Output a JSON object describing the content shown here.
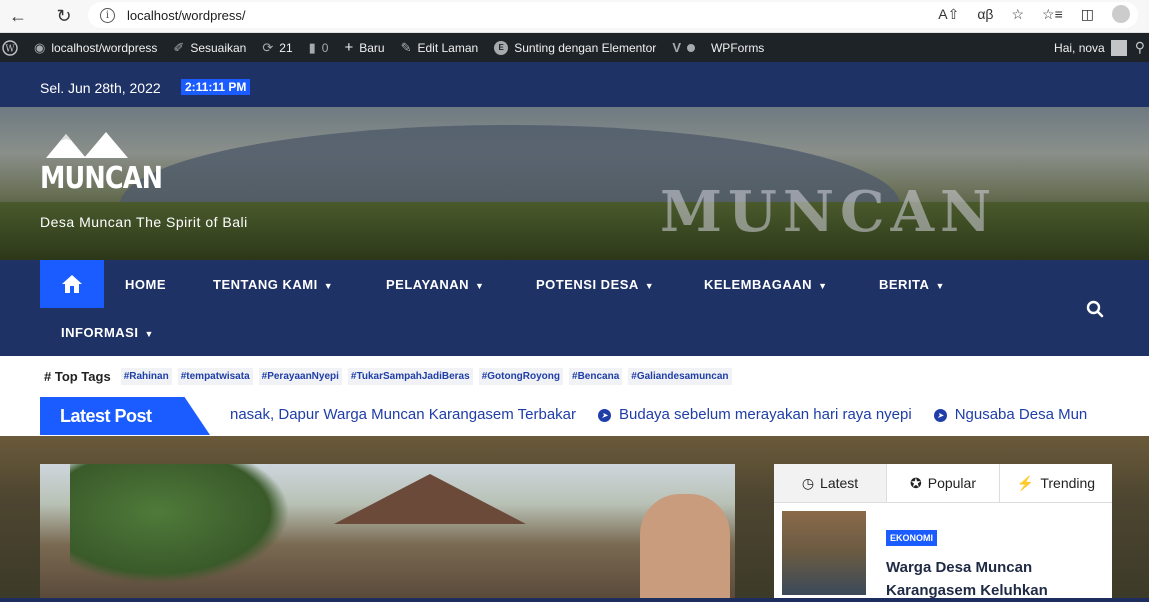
{
  "browser": {
    "url": "localhost/wordpress/"
  },
  "adminbar": {
    "site": "localhost/wordpress",
    "customize": "Sesuaikan",
    "updates": "21",
    "comments": "0",
    "new": "Baru",
    "edit": "Edit Laman",
    "elementor": "Sunting dengan Elementor",
    "wpforms": "WPForms",
    "greeting": "Hai, nova"
  },
  "header": {
    "date": "Sel. Jun 28th, 2022",
    "time": "2:11:11 PM",
    "site_title": "MUNCAN",
    "tagline": "Desa Muncan The Spirit of Bali",
    "banner_text": "MUNCAN"
  },
  "nav": {
    "items": [
      "HOME",
      "TENTANG KAMI",
      "PELAYANAN",
      "POTENSI DESA",
      "KELEMBAGAAN",
      "BERITA",
      "INFORMASI"
    ]
  },
  "tags": {
    "label": "# Top Tags",
    "items": [
      "#Rahinan",
      "#tempatwisata",
      "#PerayaanNyepi",
      "#TukarSampahJadiBeras",
      "#GotongRoyong",
      "#Bencana",
      "#Galiandesamuncan"
    ]
  },
  "ticker": {
    "label": "Latest Post",
    "items": [
      "nasak, Dapur Warga Muncan Karangasem Terbakar",
      "Budaya sebelum merayakan hari raya nyepi",
      "Ngusaba Desa Mun"
    ]
  },
  "widget": {
    "tabs": [
      "Latest",
      "Popular",
      "Trending"
    ],
    "post_category": "EKONOMI",
    "post_title": "Warga Desa Muncan Karangasem Keluhkan"
  },
  "colors": {
    "primary": "#1a5cff",
    "navy": "#1f3266",
    "adminbar": "#1d2327"
  }
}
